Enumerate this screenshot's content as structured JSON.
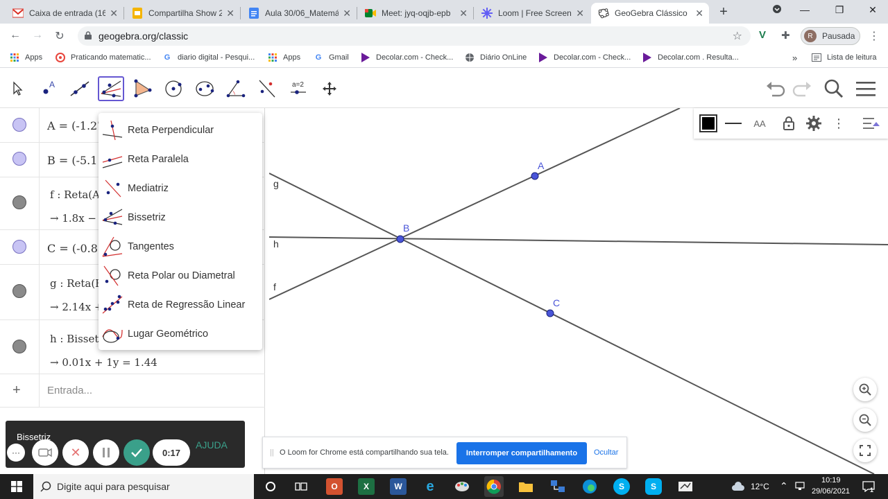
{
  "browser": {
    "tabs": [
      {
        "title": "Caixa de entrada (164",
        "icon": "gmail-icon",
        "color": "#d93025"
      },
      {
        "title": "Compartilha Show 20",
        "icon": "slides-icon",
        "color": "#f4b400"
      },
      {
        "title": "Aula 30/06_Matemát",
        "icon": "docs-icon",
        "color": "#4285f4"
      },
      {
        "title": "Meet: jyq-oqjb-epb",
        "icon": "meet-icon",
        "color": "#00832d"
      },
      {
        "title": "Loom | Free Screen &",
        "icon": "loom-icon",
        "color": "#625df5"
      },
      {
        "title": "GeoGebra Clássico",
        "icon": "geogebra-icon",
        "color": "#666666"
      }
    ],
    "url": "geogebra.org/classic",
    "profile_label": "Pausada",
    "profile_initial": "R",
    "bookmarks": [
      "Apps",
      "Praticando matematic...",
      "diario digital - Pesqui...",
      "Apps",
      "Gmail",
      "Decolar.com - Check...",
      "Diário OnLine",
      "Decolar.com - Check...",
      "Decolar.com . Resulta..."
    ],
    "bookmarks_more": "»",
    "reading_list": "Lista de leitura"
  },
  "algebra": {
    "rows": [
      {
        "line1": "A = (-1.27, 0.91)",
        "line2": ""
      },
      {
        "line1": "B = (-5.1",
        "line2": ""
      },
      {
        "line1": "f : Reta(A, B)",
        "line2": "→ 1.8x − y = −6.06"
      },
      {
        "line1": "C = (-0.8",
        "line2": ""
      },
      {
        "line1": "g : Reta(B, C)",
        "line2": "→ 2.14x + 4.8y = 1.18"
      },
      {
        "line1": "h : Bissetriz(f, g)",
        "line2": "→ 0.01x + 1y = 1.44"
      }
    ],
    "input_placeholder": "Entrada...",
    "add_symbol": "+"
  },
  "dropdown": {
    "items": [
      "Reta Perpendicular",
      "Reta Paralela",
      "Mediatriz",
      "Bissetriz",
      "Tangentes",
      "Reta Polar ou Diametral",
      "Reta de Regressão Linear",
      "Lugar Geométrico"
    ]
  },
  "graphics": {
    "points": [
      "A",
      "B",
      "C"
    ],
    "lines": [
      "g",
      "h",
      "f"
    ],
    "line_color": "#555555",
    "point_color": "#4a55d8"
  },
  "stylebar": {
    "font_label": "AA"
  },
  "tool_eq_label": "a=2",
  "loom": {
    "tool_name": "Bissetriz",
    "timer": "0:17",
    "help": "AJUDA"
  },
  "share_bar": {
    "message": "O Loom for Chrome está compartilhando sua tela.",
    "stop_label": "Interromper compartilhamento",
    "hide_label": "Ocultar"
  },
  "taskbar": {
    "search_placeholder": "Digite aqui para pesquisar",
    "temperature": "12°C",
    "time": "10:19",
    "date": "29/06/2021",
    "notif_count": "1"
  }
}
